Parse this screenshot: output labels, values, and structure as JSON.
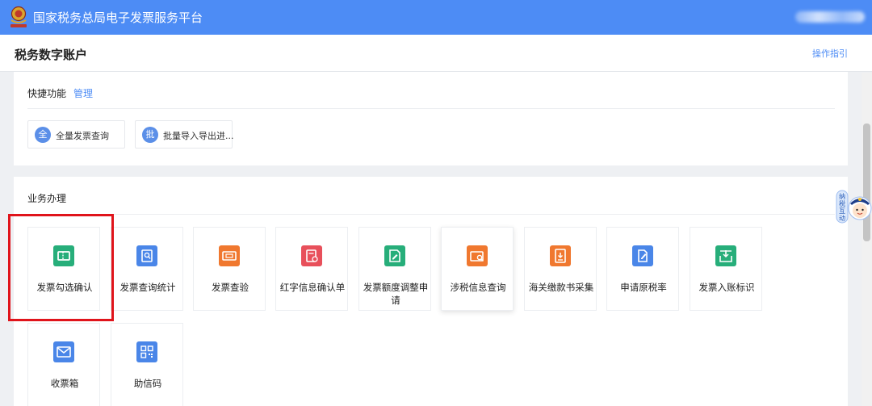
{
  "header": {
    "site_title": "国家税务总局电子发票服务平台",
    "logo_icon": "tax-emblem-icon"
  },
  "subheader": {
    "page_title": "税务数字账户",
    "guide_link": "操作指引"
  },
  "quick": {
    "title": "快捷功能",
    "manage": "管理",
    "buttons": [
      {
        "badge": "全",
        "label": "全量发票查询"
      },
      {
        "badge": "批",
        "label": "批量导入导出进..."
      }
    ]
  },
  "business": {
    "title": "业务办理",
    "tiles": [
      {
        "label": "发票勾选确认",
        "icon": "ticket-icon",
        "color": "#27ae7a"
      },
      {
        "label": "发票查询统计",
        "icon": "search-doc-icon",
        "color": "#4a86e8"
      },
      {
        "label": "发票查验",
        "icon": "ticket-check-icon",
        "color": "#f0782f"
      },
      {
        "label": "红字信息确认单",
        "icon": "red-doc-icon",
        "color": "#e8505b"
      },
      {
        "label": "发票额度调整申请",
        "icon": "edit-doc-icon",
        "color": "#27ae7a"
      },
      {
        "label": "涉税信息查询",
        "icon": "search-folder-icon",
        "color": "#f0782f"
      },
      {
        "label": "海关缴款书采集",
        "icon": "download-doc-icon",
        "color": "#f0782f"
      },
      {
        "label": "申请原税率",
        "icon": "pen-doc-icon",
        "color": "#4a86e8"
      },
      {
        "label": "发票入账标识",
        "icon": "inbox-icon",
        "color": "#27ae7a"
      },
      {
        "label": "收票箱",
        "icon": "mail-icon",
        "color": "#4a86e8"
      },
      {
        "label": "助信码",
        "icon": "qr-code-icon",
        "color": "#4a86e8"
      }
    ]
  },
  "assistant": {
    "icon": "assistant-mascot-icon",
    "chars": [
      "纳",
      "税",
      "互",
      "动"
    ]
  }
}
